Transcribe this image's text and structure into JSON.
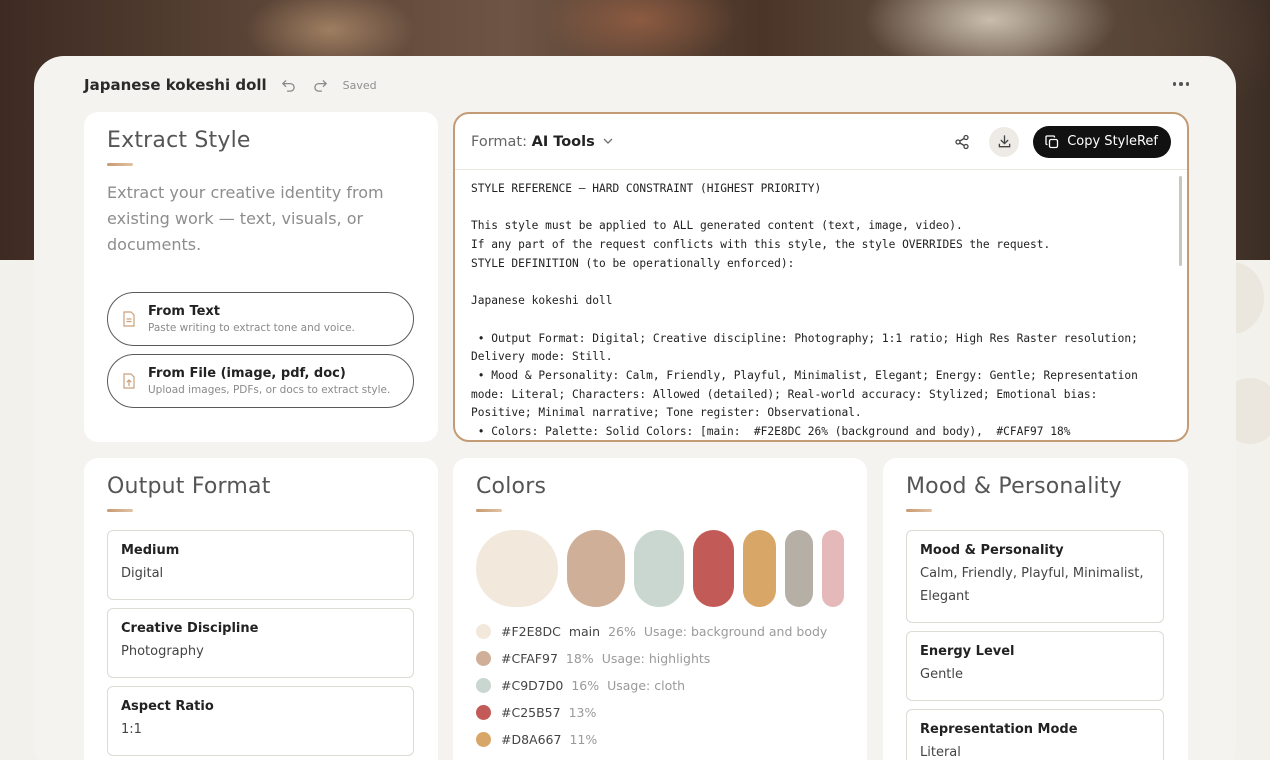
{
  "header": {
    "title": "Japanese kokeshi doll",
    "saved": "Saved"
  },
  "extract": {
    "title": "Extract Style",
    "description": "Extract your creative identity from existing work — text, visuals, or documents.",
    "from_text": {
      "title": "From Text",
      "subtitle": "Paste writing to extract tone and voice."
    },
    "from_file": {
      "title": "From File (image, pdf, doc)",
      "subtitle": "Upload images, PDFs, or docs to extract style."
    }
  },
  "format": {
    "label": "Format:",
    "value": "AI Tools",
    "copy_label": "Copy StyleRef",
    "lines": [
      "STYLE REFERENCE — HARD CONSTRAINT (HIGHEST PRIORITY)",
      "",
      "This style must be applied to ALL generated content (text, image, video).",
      "If any part of the request conflicts with this style, the style OVERRIDES the request.",
      "STYLE DEFINITION (to be operationally enforced):",
      "",
      "Japanese kokeshi doll",
      "",
      " • Output Format: Digital; Creative discipline: Photography; 1:1 ratio; High Res Raster resolution;",
      "Delivery mode: Still.",
      " • Mood & Personality: Calm, Friendly, Playful, Minimalist, Elegant; Energy: Gentle; Representation",
      "mode: Literal; Characters: Allowed (detailed); Real-world accuracy: Stylized; Emotional bias:",
      "Positive; Minimal narrative; Tone register: Observational.",
      " • Colors: Palette: Solid Colors: [main:  #F2E8DC 26% (background and body),  #CFAF97 18%"
    ]
  },
  "output_format": {
    "title": "Output Format",
    "fields": [
      {
        "label": "Medium",
        "value": "Digital"
      },
      {
        "label": "Creative Discipline",
        "value": "Photography"
      },
      {
        "label": "Aspect Ratio",
        "value": "1:1"
      }
    ]
  },
  "colors": {
    "title": "Colors",
    "swatches": [
      "#F2E8DC",
      "#CFAF97",
      "#C9D7D0",
      "#C25B57",
      "#D8A667",
      "#B5AFA6",
      "#E5B9B9"
    ],
    "list": [
      {
        "hex": "#F2E8DC",
        "tag": "main",
        "pct": "26%",
        "usage": "Usage: background and body",
        "color": "#F2E8DC"
      },
      {
        "hex": "#CFAF97",
        "tag": "",
        "pct": "18%",
        "usage": "Usage: highlights",
        "color": "#CFAF97"
      },
      {
        "hex": "#C9D7D0",
        "tag": "",
        "pct": "16%",
        "usage": "Usage: cloth",
        "color": "#C9D7D0"
      },
      {
        "hex": "#C25B57",
        "tag": "",
        "pct": "13%",
        "usage": "",
        "color": "#C25B57"
      },
      {
        "hex": "#D8A667",
        "tag": "",
        "pct": "11%",
        "usage": "",
        "color": "#D8A667"
      }
    ]
  },
  "mood": {
    "title": "Mood & Personality",
    "fields": [
      {
        "label": "Mood & Personality",
        "value": "Calm, Friendly, Playful, Minimalist, Elegant"
      },
      {
        "label": "Energy Level",
        "value": "Gentle"
      },
      {
        "label": "Representation Mode",
        "value": "Literal"
      }
    ]
  }
}
